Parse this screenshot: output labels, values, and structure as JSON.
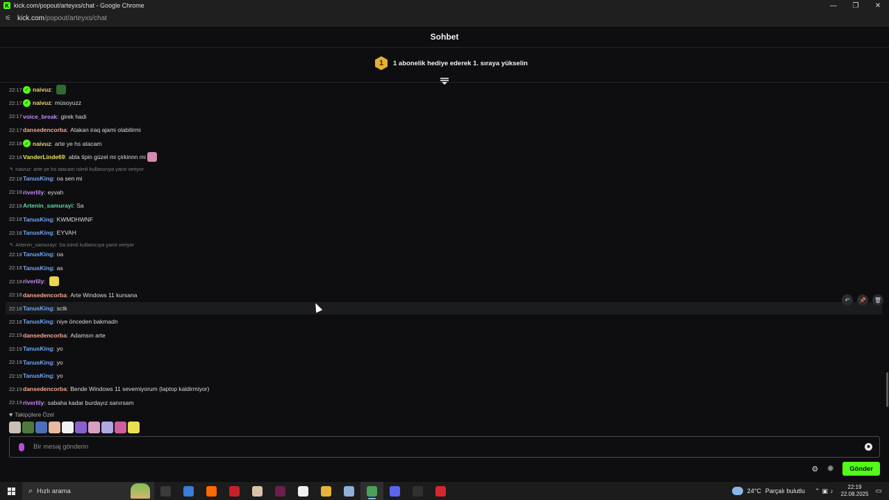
{
  "window": {
    "title": "kick.com/popout/arteyxs/chat - Google Chrome",
    "favicon": "K"
  },
  "address": {
    "host": "kick.com",
    "path": "/popout/arteyxs/chat"
  },
  "chat": {
    "title": "Sohbet",
    "gift_badge": "1",
    "gift_text": "1 abonelik hediye ederek 1. sıraya yükselin",
    "messages": [
      {
        "time": "22:17",
        "user": "naivuz",
        "verified": true,
        "color": "#f2d46a",
        "text": "",
        "emote": "#2f6b2f"
      },
      {
        "time": "22:17",
        "user": "naivuz",
        "verified": true,
        "color": "#f2d46a",
        "text": "müsoyuzz"
      },
      {
        "time": "22:17",
        "user": "voice_break",
        "verified": false,
        "color": "#c58af9",
        "text": "girek hadi"
      },
      {
        "time": "22:17",
        "user": "dansedencorba",
        "verified": false,
        "color": "#f7a78c",
        "text": "Atakan iraq ajami olabilirmi"
      },
      {
        "time": "22:18",
        "user": "naivuz",
        "verified": true,
        "color": "#f2d46a",
        "text": "arte ye hs atacam"
      },
      {
        "time": "22:18",
        "user": "VanderLinde69",
        "verified": false,
        "color": "#e8e35f",
        "text": "abla tipin güzel mi çirkinnn mi",
        "emote": "#d48ab0"
      },
      {
        "time": "22:18",
        "user": "TanusKing",
        "verified": false,
        "color": "#6fa8f5",
        "text": "oa sen mi",
        "reply": "naivuz: arte ye hs atacam isimli kullanıcıya yanıt veriyor"
      },
      {
        "time": "22:18",
        "user": "riverlily",
        "verified": false,
        "color": "#c58af9",
        "text": "eyvah"
      },
      {
        "time": "22:18",
        "user": "Artenin_samurayi",
        "verified": false,
        "color": "#5fd6a0",
        "text": "Sa"
      },
      {
        "time": "22:18",
        "user": "TanusKing",
        "verified": false,
        "color": "#6fa8f5",
        "text": "KWMDHWNF"
      },
      {
        "time": "22:18",
        "user": "TanusKing",
        "verified": false,
        "color": "#6fa8f5",
        "text": "EYVAH"
      },
      {
        "time": "22:18",
        "user": "TanusKing",
        "verified": false,
        "color": "#6fa8f5",
        "text": "oa",
        "reply": "Artenin_samurayi: Sa isimli kullanıcıya yanıt veriyor"
      },
      {
        "time": "22:18",
        "user": "TanusKing",
        "verified": false,
        "color": "#6fa8f5",
        "text": "as"
      },
      {
        "time": "22:18",
        "user": "riverlily",
        "verified": false,
        "color": "#c58af9",
        "text": "",
        "emote": "#e8d84a"
      },
      {
        "time": "22:18",
        "user": "dansedencorba",
        "verified": false,
        "color": "#f7a78c",
        "text": "Arte Windows 11 kursana"
      },
      {
        "time": "22:18",
        "user": "TanusKing",
        "verified": false,
        "color": "#6fa8f5",
        "text": "sctk",
        "hover": true
      },
      {
        "time": "22:18",
        "user": "TanusKing",
        "verified": false,
        "color": "#6fa8f5",
        "text": "niye önceden bakmadn"
      },
      {
        "time": "22:19",
        "user": "dansedencorba",
        "verified": false,
        "color": "#f7a78c",
        "text": "Adamsın arte"
      },
      {
        "time": "22:19",
        "user": "TanusKing",
        "verified": false,
        "color": "#6fa8f5",
        "text": "yo"
      },
      {
        "time": "22:19",
        "user": "TanusKing",
        "verified": false,
        "color": "#6fa8f5",
        "text": "yo"
      },
      {
        "time": "22:19",
        "user": "TanusKing",
        "verified": false,
        "color": "#6fa8f5",
        "text": "yo"
      },
      {
        "time": "22:19",
        "user": "dansedencorba",
        "verified": false,
        "color": "#f7a78c",
        "text": "Bende Windows 11 sevemiyorum (laptop kaldirmiyor)"
      },
      {
        "time": "22:19",
        "user": "riverlily",
        "verified": false,
        "color": "#c58af9",
        "text": "sabaha kadar burdayız sanırsam"
      }
    ],
    "followers_label": "Takipçilere Özel",
    "emote_colors": [
      "#c9c0b5",
      "#4d7a3a",
      "#4a6fb8",
      "#e9b9a0",
      "#f0f0f0",
      "#8a5fd0",
      "#d8a0c0",
      "#b0a8e0",
      "#d05fa0",
      "#e8e050"
    ],
    "input_placeholder": "Bir mesaj gönderin",
    "send_label": "Gönder"
  },
  "taskbar": {
    "search_label": "Hızlı arama",
    "apps": [
      {
        "name": "task-view",
        "color": "#3a3a3a"
      },
      {
        "name": "app-blue",
        "color": "#3b7dd8"
      },
      {
        "name": "illustrator",
        "color": "#ff6a00",
        "label": "Ai"
      },
      {
        "name": "app-red",
        "color": "#c8202a"
      },
      {
        "name": "app-image",
        "color": "#d9c3a8"
      },
      {
        "name": "app-purple",
        "color": "#6a1f4f"
      },
      {
        "name": "capcut",
        "color": "#f0f0f0"
      },
      {
        "name": "chrome",
        "color": "#e8b33a"
      },
      {
        "name": "app-notes",
        "color": "#8fb0d8"
      },
      {
        "name": "chrome-active",
        "color": "#4aa05a",
        "active": true
      },
      {
        "name": "discord",
        "color": "#5865f2"
      },
      {
        "name": "obs",
        "color": "#303030"
      },
      {
        "name": "app-red2",
        "color": "#d8262e"
      }
    ],
    "weather_temp": "24°C",
    "weather_text": "Parçalı bulutlu",
    "time": "22:19",
    "date": "22.08.2025"
  }
}
